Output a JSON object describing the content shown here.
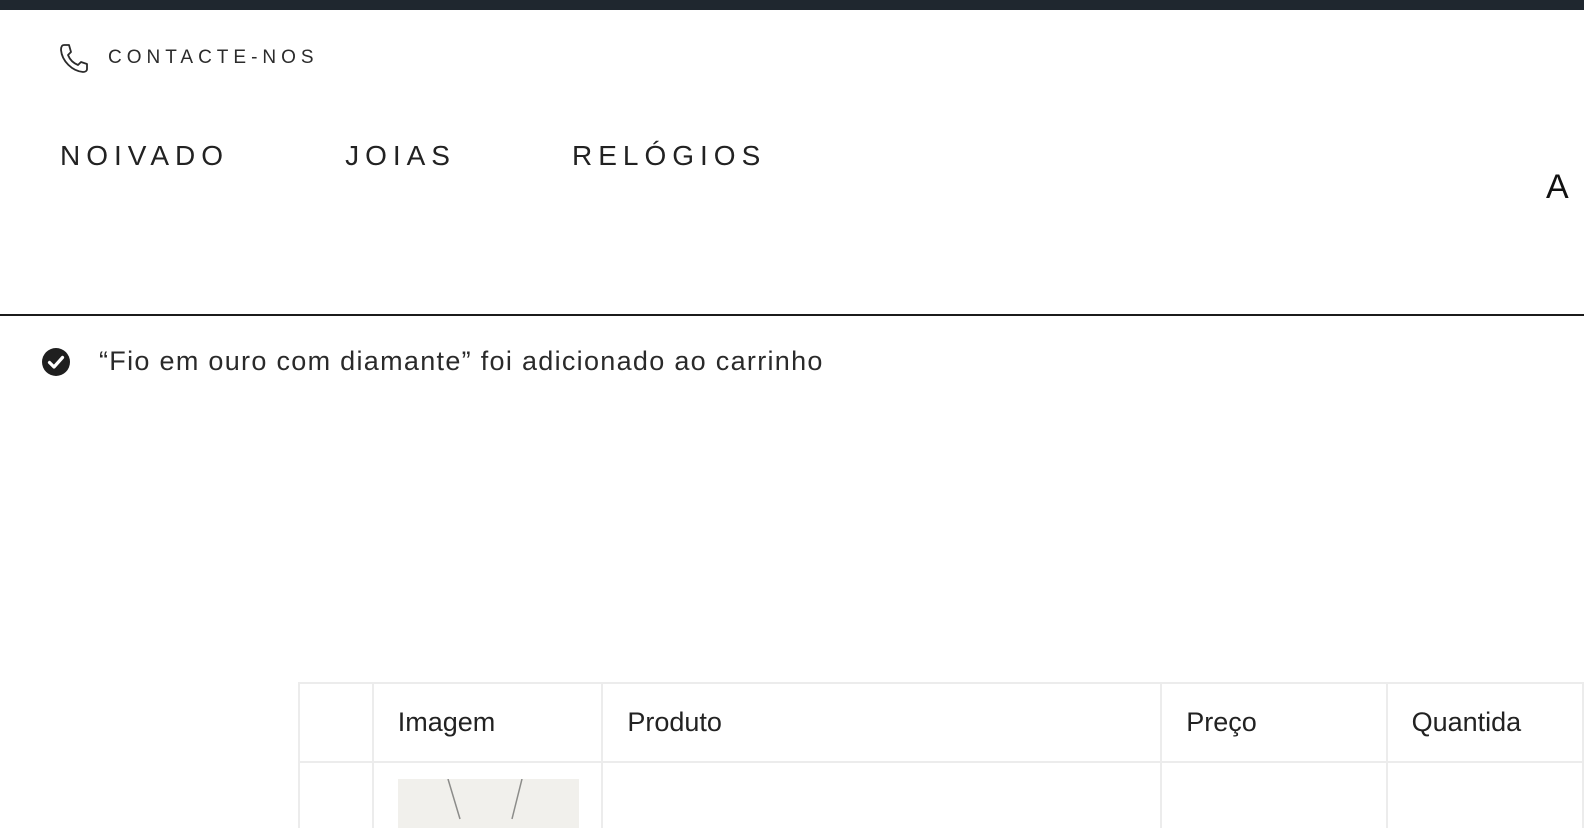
{
  "header": {
    "contact_label": "CONTACTE-NOS",
    "contact_icon": "phone-icon"
  },
  "nav": {
    "items": [
      {
        "label": "NOIVADO"
      },
      {
        "label": "JOIAS"
      },
      {
        "label": "RELÓGIOS"
      }
    ],
    "partial_item": "A"
  },
  "notice": {
    "icon": "check-circle-icon",
    "message": "“Fio em ouro com diamante” foi adicionado ao carrinho"
  },
  "cart": {
    "columns": [
      "",
      "Imagem",
      "Produto",
      "Preço",
      "Quantida"
    ],
    "rows": [
      {
        "image": "necklace-thumbnail"
      }
    ]
  },
  "colors": {
    "topbar": "#1f272f",
    "text": "#222222",
    "divider": "#1b1b1b",
    "table_border": "#ececec",
    "thumb_bg": "#f1f0ec"
  }
}
